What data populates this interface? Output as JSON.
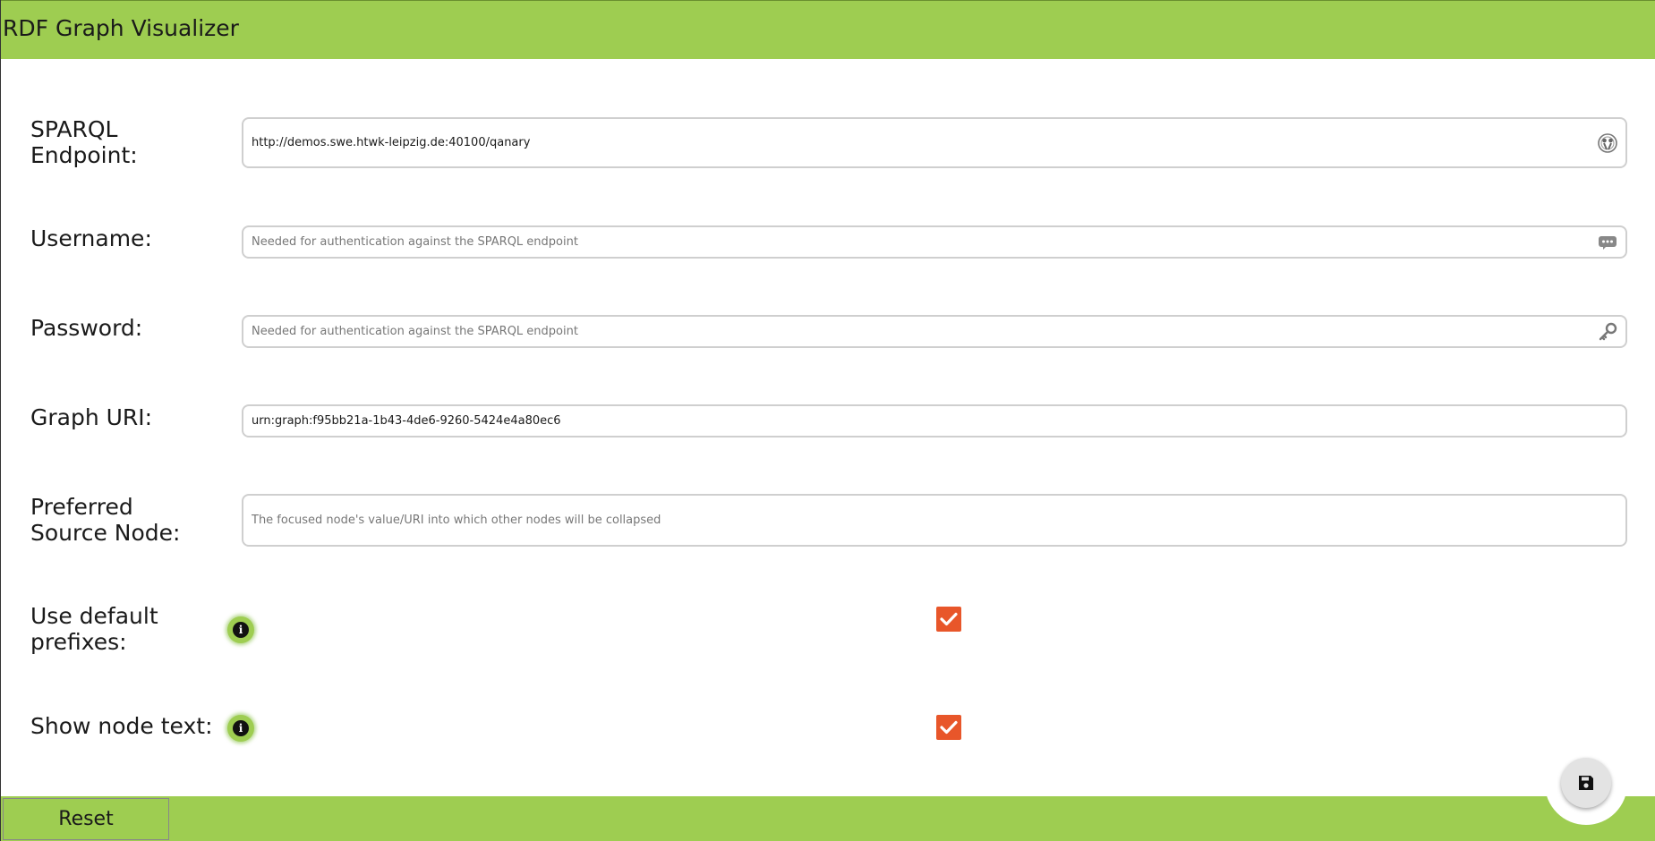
{
  "app": {
    "title": "RDF Graph Visualizer"
  },
  "form": {
    "sparql_endpoint": {
      "label": "SPARQL Endpoint:",
      "value": "http://demos.swe.htwk-leipzig.de:40100/qanary",
      "placeholder": "",
      "icon": "endpoint-icon"
    },
    "username": {
      "label": "Username:",
      "value": "",
      "placeholder": "Needed for authentication against the SPARQL endpoint",
      "icon": "dots-bubble-icon"
    },
    "password": {
      "label": "Password:",
      "value": "",
      "placeholder": "Needed for authentication against the SPARQL endpoint",
      "icon": "key-icon"
    },
    "graph_uri": {
      "label": "Graph URI:",
      "value": "urn:graph:f95bb21a-1b43-4de6-9260-5424e4a80ec6",
      "placeholder": ""
    },
    "preferred_source_node": {
      "label": "Preferred Source Node:",
      "value": "",
      "placeholder": "The focused node's value/URI into which other nodes will be collapsed"
    },
    "use_default_prefixes": {
      "label": "Use default prefixes:",
      "checked": true,
      "info_icon": "info-icon"
    },
    "show_node_text": {
      "label": "Show node text:",
      "checked": true,
      "info_icon": "info-icon"
    }
  },
  "footer": {
    "reset_label": "Reset",
    "save_icon": "floppy-disk-icon"
  },
  "colors": {
    "accent_green": "#9ecd51",
    "checkbox_orange": "#e8562a"
  }
}
